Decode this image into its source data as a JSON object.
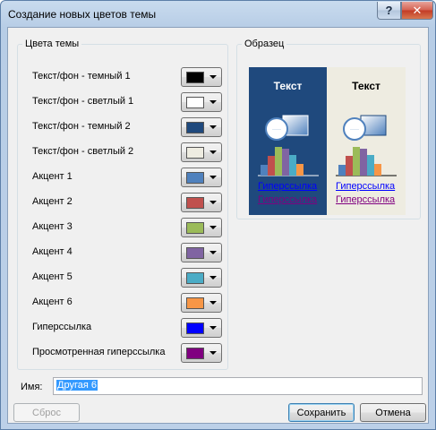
{
  "window": {
    "title": "Создание новых цветов темы",
    "help_glyph": "?",
    "close_glyph": "✕"
  },
  "colors_group": {
    "legend": "Цвета темы",
    "rows": [
      {
        "label": "Текст/фон - темный 1",
        "color": "#000000"
      },
      {
        "label": "Текст/фон - светлый 1",
        "color": "#ffffff"
      },
      {
        "label": "Текст/фон - темный 2",
        "color": "#1f497d"
      },
      {
        "label": "Текст/фон - светлый 2",
        "color": "#eeece1"
      },
      {
        "label": "Акцент 1",
        "color": "#4f81bd"
      },
      {
        "label": "Акцент 2",
        "color": "#c0504d"
      },
      {
        "label": "Акцент 3",
        "color": "#9bbb59"
      },
      {
        "label": "Акцент 4",
        "color": "#8064a2"
      },
      {
        "label": "Акцент 5",
        "color": "#4bacc6"
      },
      {
        "label": "Акцент 6",
        "color": "#f79646"
      },
      {
        "label": "Гиперссылка",
        "color": "#0000ff"
      },
      {
        "label": "Просмотренная гиперссылка",
        "color": "#800080"
      }
    ]
  },
  "sample_group": {
    "legend": "Образец",
    "dark_panel": {
      "title": "Текст",
      "hyperlink": "Гиперссылка",
      "visited": "Гиперссылка"
    },
    "light_panel": {
      "title": "Текст",
      "hyperlink": "Гиперссылка",
      "visited": "Гиперссылка"
    }
  },
  "name": {
    "label": "Имя:",
    "value": "Другая 6"
  },
  "buttons": {
    "reset": "Сброс",
    "save": "Сохранить",
    "cancel": "Отмена"
  }
}
